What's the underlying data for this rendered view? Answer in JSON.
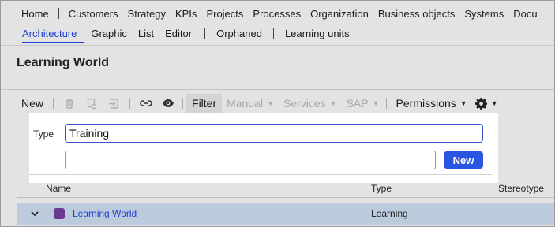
{
  "nav": {
    "primary": [
      "Home",
      "Customers",
      "Strategy",
      "KPIs",
      "Projects",
      "Processes",
      "Organization",
      "Business objects",
      "Systems",
      "Docu"
    ],
    "secondary": [
      "Architecture",
      "Graphic",
      "List",
      "Editor",
      "Orphaned",
      "Learning units"
    ],
    "active_secondary": "Architecture"
  },
  "page": {
    "title": "Learning World"
  },
  "toolbar": {
    "new_label": "New",
    "filter_label": "Filter",
    "manual_label": "Manual",
    "services_label": "Services",
    "sap_label": "SAP",
    "permissions_label": "Permissions",
    "icons": [
      "trash-icon",
      "copy-icon",
      "move-icon",
      "link-icon",
      "eye-icon",
      "gear-icon"
    ]
  },
  "filter_panel": {
    "type_label": "Type",
    "type_value": "Training",
    "search_value": "",
    "new_button_label": "New"
  },
  "table": {
    "columns": [
      "Name",
      "Type",
      "Stereotype"
    ],
    "rows": [
      {
        "name": "Learning World",
        "type": "Learning",
        "stereotype": "",
        "color": "#6a3a92"
      }
    ]
  },
  "colors": {
    "accent": "#1d3fd0",
    "button": "#2a55e0",
    "row_selected": "#bccbdc"
  }
}
